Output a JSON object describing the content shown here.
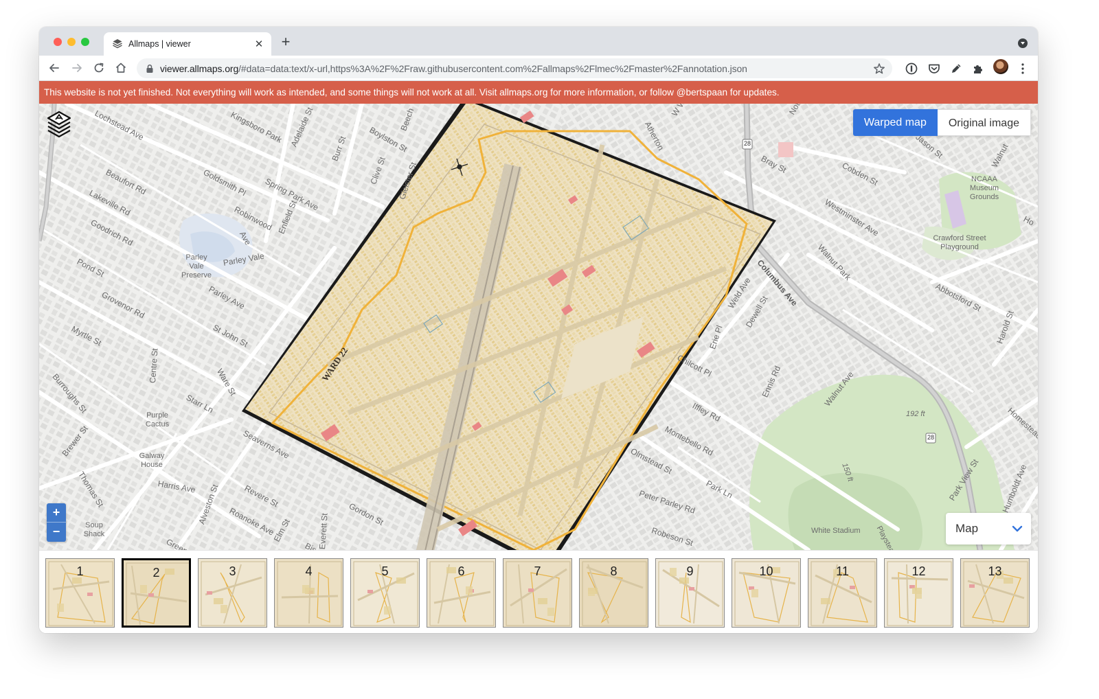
{
  "browser": {
    "tab_title": "Allmaps | viewer",
    "tab_close": "✕",
    "new_tab": "+",
    "url_host": "viewer.allmaps.org",
    "url_path": "/#data=data:text/x-url,https%3A%2F%2Fraw.githubusercontent.com%2Fallmaps%2Flmec%2Fmaster%2Fannotation.json"
  },
  "banner": {
    "text": "This website is not yet finished. Not everything will work as intended, and some things will not work at all. Visit allmaps.org for more information, or follow @bertspaan for updates."
  },
  "view_toggle": {
    "warped": "Warped map",
    "original": "Original image"
  },
  "zoom": {
    "in": "+",
    "out": "−"
  },
  "basemap": {
    "selected": "Map"
  },
  "map_labels": {
    "lochstead": "Lochstead Ave",
    "kingsboro": "Kingsboro Park",
    "adelaide": "Adelaide St",
    "burr": "Burr St",
    "boylston": "Boylston St",
    "clive": "Clive St",
    "gleister": "Gleister St",
    "beech": "Beech",
    "walnut_w": "W Walnut Park",
    "atherton": "Atherton",
    "notre": "Notre",
    "beaufort": "Beaufort Rd",
    "goldsmith": "Goldsmith Pl",
    "spring_park": "Spring Park Ave",
    "lakeville": "Lakeville Rd",
    "robinwood": "Robinwood",
    "robinwood_ave": "Ave",
    "enfield": "Enfield St",
    "goodrich": "Goodrich Rd",
    "parley_preserve": "Parley Vale Preserve",
    "parley_vale": "Parley Vale",
    "parley_ave": "Parley Ave",
    "pond": "Pond St",
    "grovenor": "Grovenor Rd",
    "st_john": "St John St",
    "myrtle": "Myrtle St",
    "ware": "Ware St",
    "burroughs": "Burroughs St",
    "centre": "Centre St",
    "starr": "Starr Ln",
    "purple_cactus": "Purple Cactus",
    "seaverns": "Seaverns Ave",
    "brewer": "Brewer St",
    "galway": "Galway House",
    "thomas": "Thomas St",
    "harris": "Harris Ave",
    "alveston": "Alveston St",
    "revere": "Revere St",
    "roanoke": "Roanoke Ave",
    "soup_shack": "Soup Shack",
    "greenough": "Greenough",
    "elm": "Elm St",
    "everett": "Everett St",
    "gordon": "Gordon St",
    "bis": "Bis",
    "bray": "Bray St",
    "cobden": "Cobden St",
    "jason": "Jason St",
    "walnut_ave_top": "Walnut",
    "ncaaa": "NCAAA Museum Grounds",
    "westminster": "Westminster Ave",
    "crawford": "Crawford Street Playground",
    "walnut_park": "Walnut Park",
    "columbus": "Columbus Ave",
    "weld": "Weld Ave",
    "dewell": "Dewell St",
    "abbotsford": "Abbotsford St",
    "harold": "Harold St",
    "erie": "Erie Pl",
    "chilcott": "Chilcott Pl",
    "ennis": "Ennis Rd",
    "walnut_ave": "Walnut Ave",
    "iffley": "Iffley Rd",
    "montebello": "Montebello Rd",
    "olmstead": "Olmstead St",
    "peter_parley": "Peter Parley Rd",
    "park_ln": "Park Ln",
    "robeson": "Robeson St",
    "white_stadium": "White Stadium",
    "playstead": "Playstead",
    "elev_192": "192 ft",
    "elev_150": "150 ft",
    "homestead": "Homestead",
    "park_view": "Park View St",
    "humboldt": "Humboldt Ave",
    "ho": "Ho",
    "route_28": "28",
    "ward_title": "WARD 22"
  },
  "thumbnails": [
    {
      "label": "1",
      "selected": false
    },
    {
      "label": "2",
      "selected": true
    },
    {
      "label": "3",
      "selected": false
    },
    {
      "label": "4",
      "selected": false
    },
    {
      "label": "5",
      "selected": false
    },
    {
      "label": "6",
      "selected": false
    },
    {
      "label": "7",
      "selected": false
    },
    {
      "label": "8",
      "selected": false
    },
    {
      "label": "9",
      "selected": false
    },
    {
      "label": "10",
      "selected": false
    },
    {
      "label": "11",
      "selected": false
    },
    {
      "label": "12",
      "selected": false
    },
    {
      "label": "13",
      "selected": false
    }
  ],
  "colors": {
    "banner": "#d65f4a",
    "accent": "#3273dc",
    "park_green": "#d3e6c4",
    "map_paper": "#eee0c0",
    "ward_outline": "#f0b23a"
  },
  "icons": [
    "allmaps-logo-icon",
    "back-icon",
    "forward-icon",
    "reload-icon",
    "home-icon",
    "lock-icon",
    "bookmark-star-icon",
    "chevron-down-icon"
  ]
}
